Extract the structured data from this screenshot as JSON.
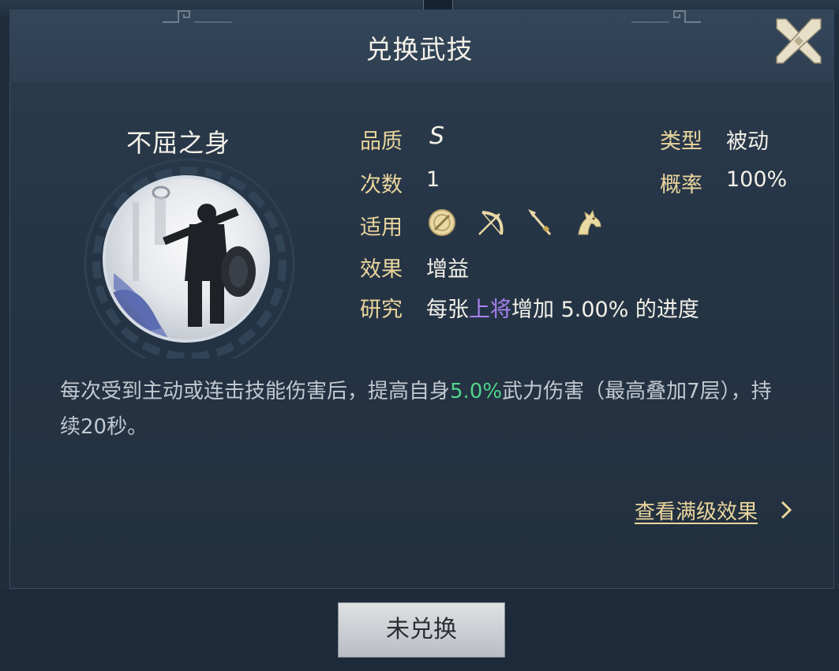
{
  "dialog": {
    "title": "兑换武技",
    "close_icon": "crossed-swords-close-icon"
  },
  "skill": {
    "name": "不屈之身",
    "portrait_icon": "warrior-with-shield-portrait",
    "quality_label": "品质",
    "quality_value": "S",
    "type_label": "类型",
    "type_value": "被动",
    "count_label": "次数",
    "count_value": "1",
    "rate_label": "概率",
    "rate_value": "100%",
    "applicable_label": "适用",
    "applicable_icons": [
      "shield-icon",
      "bow-icon",
      "spear-icon",
      "horse-icon"
    ],
    "effect_label": "效果",
    "effect_value": "增益",
    "research_label": "研究",
    "research_prefix": "每张",
    "research_highlight": "上将",
    "research_suffix": "增加 5.00% 的进度"
  },
  "description": {
    "part1": "每次受到主动或连击技能伤害后，提高自身",
    "highlight": "5.0%",
    "part2": "武力伤害（最高叠加7层），持续20秒。"
  },
  "full_level_link": "查看满级效果",
  "redeem_button": "未兑换",
  "colors": {
    "background": "#253445",
    "label_gold": "#ead59c",
    "highlight_purple": "#a883f0",
    "highlight_green": "#52d489",
    "button_grey": "#c9ccd0"
  }
}
